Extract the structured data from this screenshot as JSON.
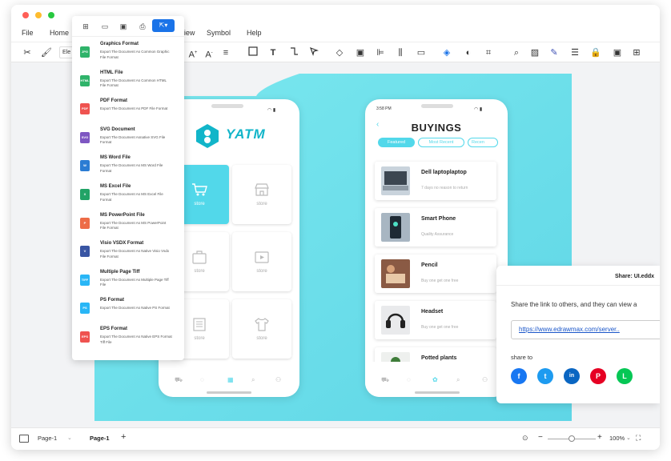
{
  "window": {
    "traffic_lights": {
      "close": "#ff5f57",
      "minimize": "#febc2e",
      "maximize": "#28c840"
    }
  },
  "menu": {
    "items": [
      "File",
      "Home",
      "View",
      "Symbol",
      "Help"
    ]
  },
  "toolbar": {
    "font_select_partial": "Ele",
    "icons": [
      "scissors-icon",
      "format-painter-icon",
      "font-grow-icon",
      "font-shrink-icon",
      "align-icon",
      "rectangle-icon",
      "text-icon",
      "connector-icon",
      "pointer-icon",
      "layers-icon",
      "group-icon",
      "align-left-icon",
      "distribute-icon",
      "frame-icon",
      "fill-icon",
      "shadow-icon",
      "crop-icon",
      "search-icon",
      "image-icon",
      "line-color-icon",
      "line-style-icon",
      "lock-icon",
      "fit-icon",
      "more-icon"
    ]
  },
  "export_menu": {
    "top_icons": [
      "new-icon",
      "open-icon",
      "save-icon",
      "print-icon",
      "export-icon"
    ],
    "formats": [
      {
        "title": "Graphics Format",
        "desc": "Export The Document As Common Graphic File Format",
        "badge": "JPG",
        "color": "#2fb36a"
      },
      {
        "title": "HTML File",
        "desc": "Export The Document As Common HTML File Format",
        "badge": "HTML",
        "color": "#2fb36a"
      },
      {
        "title": "PDF Format",
        "desc": "Export The Document As PDF File Format",
        "badge": "PDF",
        "color": "#ef5350"
      },
      {
        "title": "SVG Document",
        "desc": "Export The Document Asnative SVG File Format",
        "badge": "SVG",
        "color": "#7e57c2"
      },
      {
        "title": "MS Word File",
        "desc": "Export The Document As MS Word File Format",
        "badge": "W",
        "color": "#2b7cd3"
      },
      {
        "title": "MS Excel File",
        "desc": "Export The Document As MS Excel File Format",
        "badge": "X",
        "color": "#21a366"
      },
      {
        "title": "MS PowerPoint File",
        "desc": "Export The Document As MS PowerPoint File Format",
        "badge": "P",
        "color": "#ed6c47"
      },
      {
        "title": "Visio VSDX Format",
        "desc": "Export The Document As Native Visio Vsdx File Format",
        "badge": "V",
        "color": "#3955a3"
      },
      {
        "title": "Multiple Page Tiff",
        "desc": "Export The Document As Multiple Page Tiff File",
        "badge": "TIFF",
        "color": "#29b6f6"
      },
      {
        "title": "PS Format",
        "desc": "Export The Document As Native PS Format",
        "badge": "PS",
        "color": "#29b6f6"
      },
      {
        "title": "EPS Format",
        "desc": "Export The Document As Native EPS Format Tiff File",
        "badge": "EPS",
        "color": "#ef5350"
      }
    ]
  },
  "phone1": {
    "brand": "YATM",
    "tiles": [
      "store",
      "store",
      "store",
      "store",
      "store",
      "store"
    ]
  },
  "phone2": {
    "time": "3:58 PM",
    "title": "BUYINGS",
    "tabs": [
      "Featured",
      "Most Recent",
      "Recen"
    ],
    "items": [
      {
        "name": "Dell laptoplaptop",
        "sub": "7 days no reason to return"
      },
      {
        "name": "Smart Phone",
        "sub": "Quality Assurance"
      },
      {
        "name": "Pencil",
        "sub": "Buy one get one free"
      },
      {
        "name": "Headset",
        "sub": "Buy one get one free"
      },
      {
        "name": "Potted plants",
        "sub": ""
      }
    ]
  },
  "share_panel": {
    "title": "Share: UI.eddx",
    "message": "Share the link to others, and they can view a",
    "link": "https://www.edrawmax.com/server..",
    "share_to": "share to",
    "networks": [
      {
        "icon": "facebook-icon",
        "glyph": "f",
        "color": "#1877f2"
      },
      {
        "icon": "twitter-icon",
        "glyph": "t",
        "color": "#1d9bf0"
      },
      {
        "icon": "linkedin-icon",
        "glyph": "in",
        "color": "#0a66c2"
      },
      {
        "icon": "pinterest-icon",
        "glyph": "P",
        "color": "#e60023"
      },
      {
        "icon": "line-icon",
        "glyph": "L",
        "color": "#06c755"
      }
    ]
  },
  "status": {
    "page_select": "Page-1",
    "page_tab": "Page-1",
    "add": "+",
    "zoom": "100%",
    "zoom_level": 0.5
  }
}
